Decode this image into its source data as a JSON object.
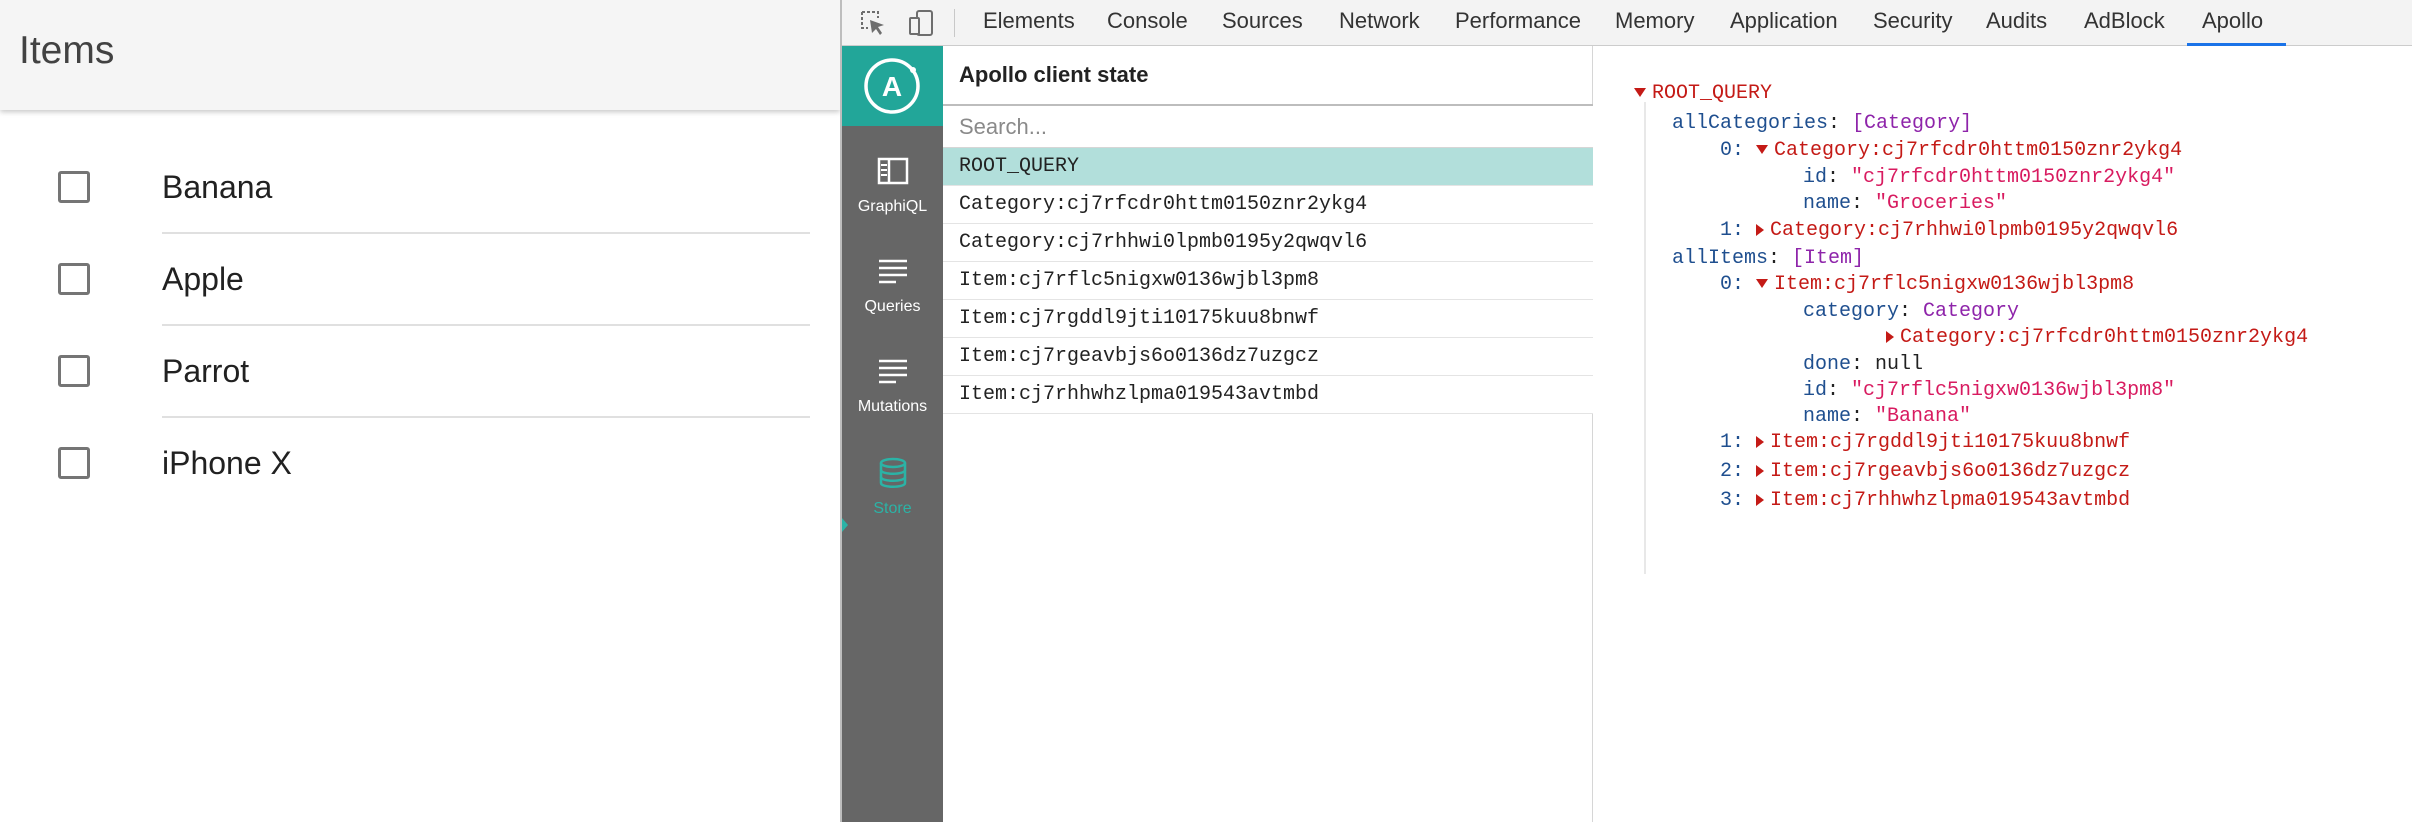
{
  "app": {
    "title": "Items",
    "items": [
      {
        "label": "Banana",
        "checked": false
      },
      {
        "label": "Apple",
        "checked": false
      },
      {
        "label": "Parrot",
        "checked": false
      },
      {
        "label": "iPhone X",
        "checked": false
      }
    ]
  },
  "devtools": {
    "tabs": [
      "Elements",
      "Console",
      "Sources",
      "Network",
      "Performance",
      "Memory",
      "Application",
      "Security",
      "Audits",
      "AdBlock",
      "Apollo"
    ],
    "active_tab": "Apollo",
    "toolbar_icons": [
      "element-picker-icon",
      "device-toggle-icon"
    ],
    "accent_color": "#1a73e8"
  },
  "apollo": {
    "logo_letter": "A",
    "brand_color": "#22a699",
    "sidebar": [
      {
        "label": "GraphiQL",
        "icon": "graphiql-icon"
      },
      {
        "label": "Queries",
        "icon": "queries-icon"
      },
      {
        "label": "Mutations",
        "icon": "mutations-icon"
      },
      {
        "label": "Store",
        "icon": "store-icon",
        "active": true
      }
    ],
    "panel_title": "Apollo client state",
    "search_placeholder": "Search...",
    "store_keys": [
      "ROOT_QUERY",
      "Category:cj7rfcdr0httm0150znr2ykg4",
      "Category:cj7rhhwi0lpmb0195y2qwqvl6",
      "Item:cj7rflc5nigxw0136wjbl3pm8",
      "Item:cj7rgddl9jti10175kuu8bnwf",
      "Item:cj7rgeavbjs6o0136dz7uzgcz",
      "Item:cj7rhhwhzlpma019543avtmbd"
    ],
    "selected_key": "ROOT_QUERY",
    "tree": {
      "root": "ROOT_QUERY",
      "allCategories_key": "allCategories",
      "allCategories_type": "[Category]",
      "cat0_index": "0:",
      "cat0_ref": "Category:cj7rfcdr0httm0150znr2ykg4",
      "cat0_id_key": "id",
      "cat0_id_val": "\"cj7rfcdr0httm0150znr2ykg4\"",
      "cat0_name_key": "name",
      "cat0_name_val": "\"Groceries\"",
      "cat1_index": "1:",
      "cat1_ref": "Category:cj7rhhwi0lpmb0195y2qwqvl6",
      "allItems_key": "allItems",
      "allItems_type": "[Item]",
      "item0_index": "0:",
      "item0_ref": "Item:cj7rflc5nigxw0136wjbl3pm8",
      "item0_category_key": "category",
      "item0_category_type": "Category",
      "item0_category_ref": "Category:cj7rfcdr0httm0150znr2ykg4",
      "item0_done_key": "done",
      "item0_done_val": "null",
      "item0_id_key": "id",
      "item0_id_val": "\"cj7rflc5nigxw0136wjbl3pm8\"",
      "item0_name_key": "name",
      "item0_name_val": "\"Banana\"",
      "item1_index": "1:",
      "item1_ref": "Item:cj7rgddl9jti10175kuu8bnwf",
      "item2_index": "2:",
      "item2_ref": "Item:cj7rgeavbjs6o0136dz7uzgcz",
      "item3_index": "3:",
      "item3_ref": "Item:cj7rhhwhzlpma019543avtmbd"
    }
  }
}
